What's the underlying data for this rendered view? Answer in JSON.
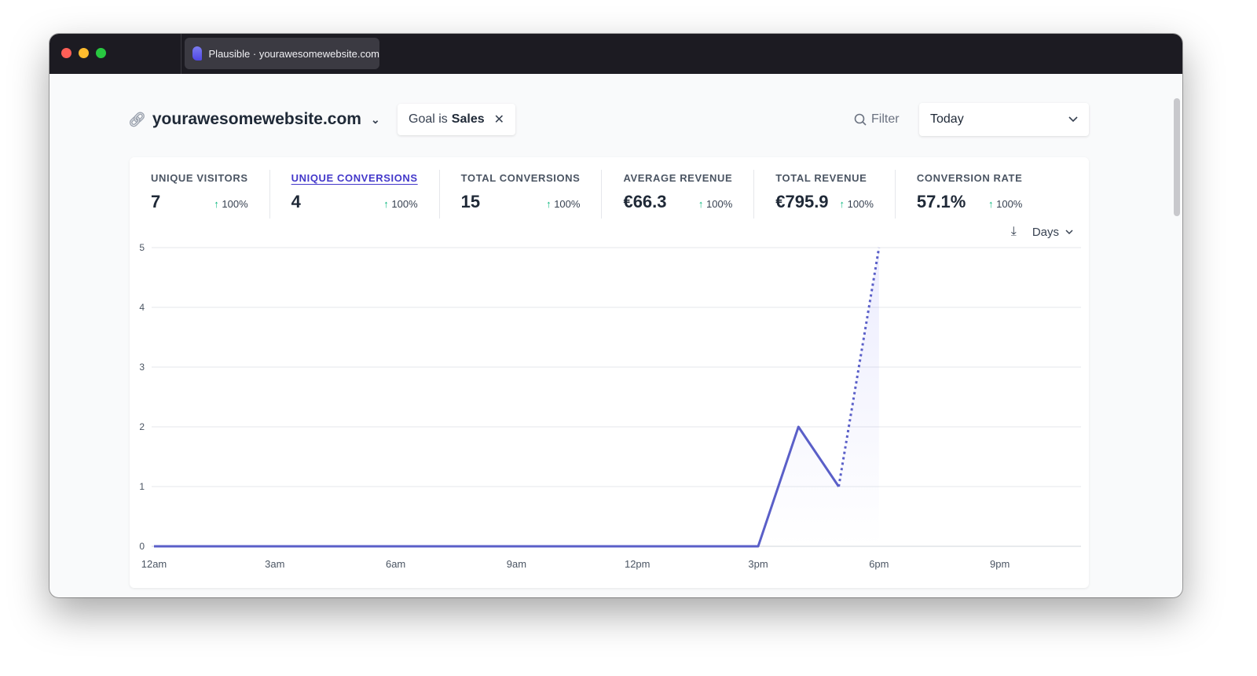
{
  "browser": {
    "tab_title": "Plausible · yourawesomewebsite.com"
  },
  "header": {
    "site": "yourawesomewebsite.com",
    "filter_prefix": "Goal is",
    "filter_value": "Sales",
    "filter_button": "Filter",
    "period": "Today"
  },
  "metrics": [
    {
      "label": "UNIQUE VISITORS",
      "value": "7",
      "change": "100%"
    },
    {
      "label": "UNIQUE CONVERSIONS",
      "value": "4",
      "change": "100%",
      "active": true
    },
    {
      "label": "TOTAL CONVERSIONS",
      "value": "15",
      "change": "100%"
    },
    {
      "label": "AVERAGE REVENUE",
      "value": "€66.3",
      "change": "100%"
    },
    {
      "label": "TOTAL REVENUE",
      "value": "€795.9",
      "change": "100%"
    },
    {
      "label": "CONVERSION RATE",
      "value": "57.1%",
      "change": "100%"
    }
  ],
  "chart_tools": {
    "interval": "Days"
  },
  "colors": {
    "line": "#5a5fc8",
    "accent": "#4338ca",
    "positive": "#10b981"
  },
  "chart_data": {
    "type": "line",
    "x": [
      0,
      1,
      2,
      3,
      4,
      5,
      6,
      7,
      8,
      9,
      10,
      11,
      12,
      13,
      14,
      15,
      16,
      17,
      18
    ],
    "values": [
      0,
      0,
      0,
      0,
      0,
      0,
      0,
      0,
      0,
      0,
      0,
      0,
      0,
      0,
      0,
      0,
      2,
      1,
      5
    ],
    "partial_from_index": 17,
    "xticks": [
      "12am",
      "3am",
      "6am",
      "9am",
      "12pm",
      "3pm",
      "6pm",
      "9pm"
    ],
    "xtick_hours": [
      0,
      3,
      6,
      9,
      12,
      15,
      18,
      21
    ],
    "yticks": [
      0,
      1,
      2,
      3,
      4,
      5
    ],
    "ylim": [
      0,
      5
    ],
    "xlim": [
      0,
      23
    ],
    "grid": true
  }
}
